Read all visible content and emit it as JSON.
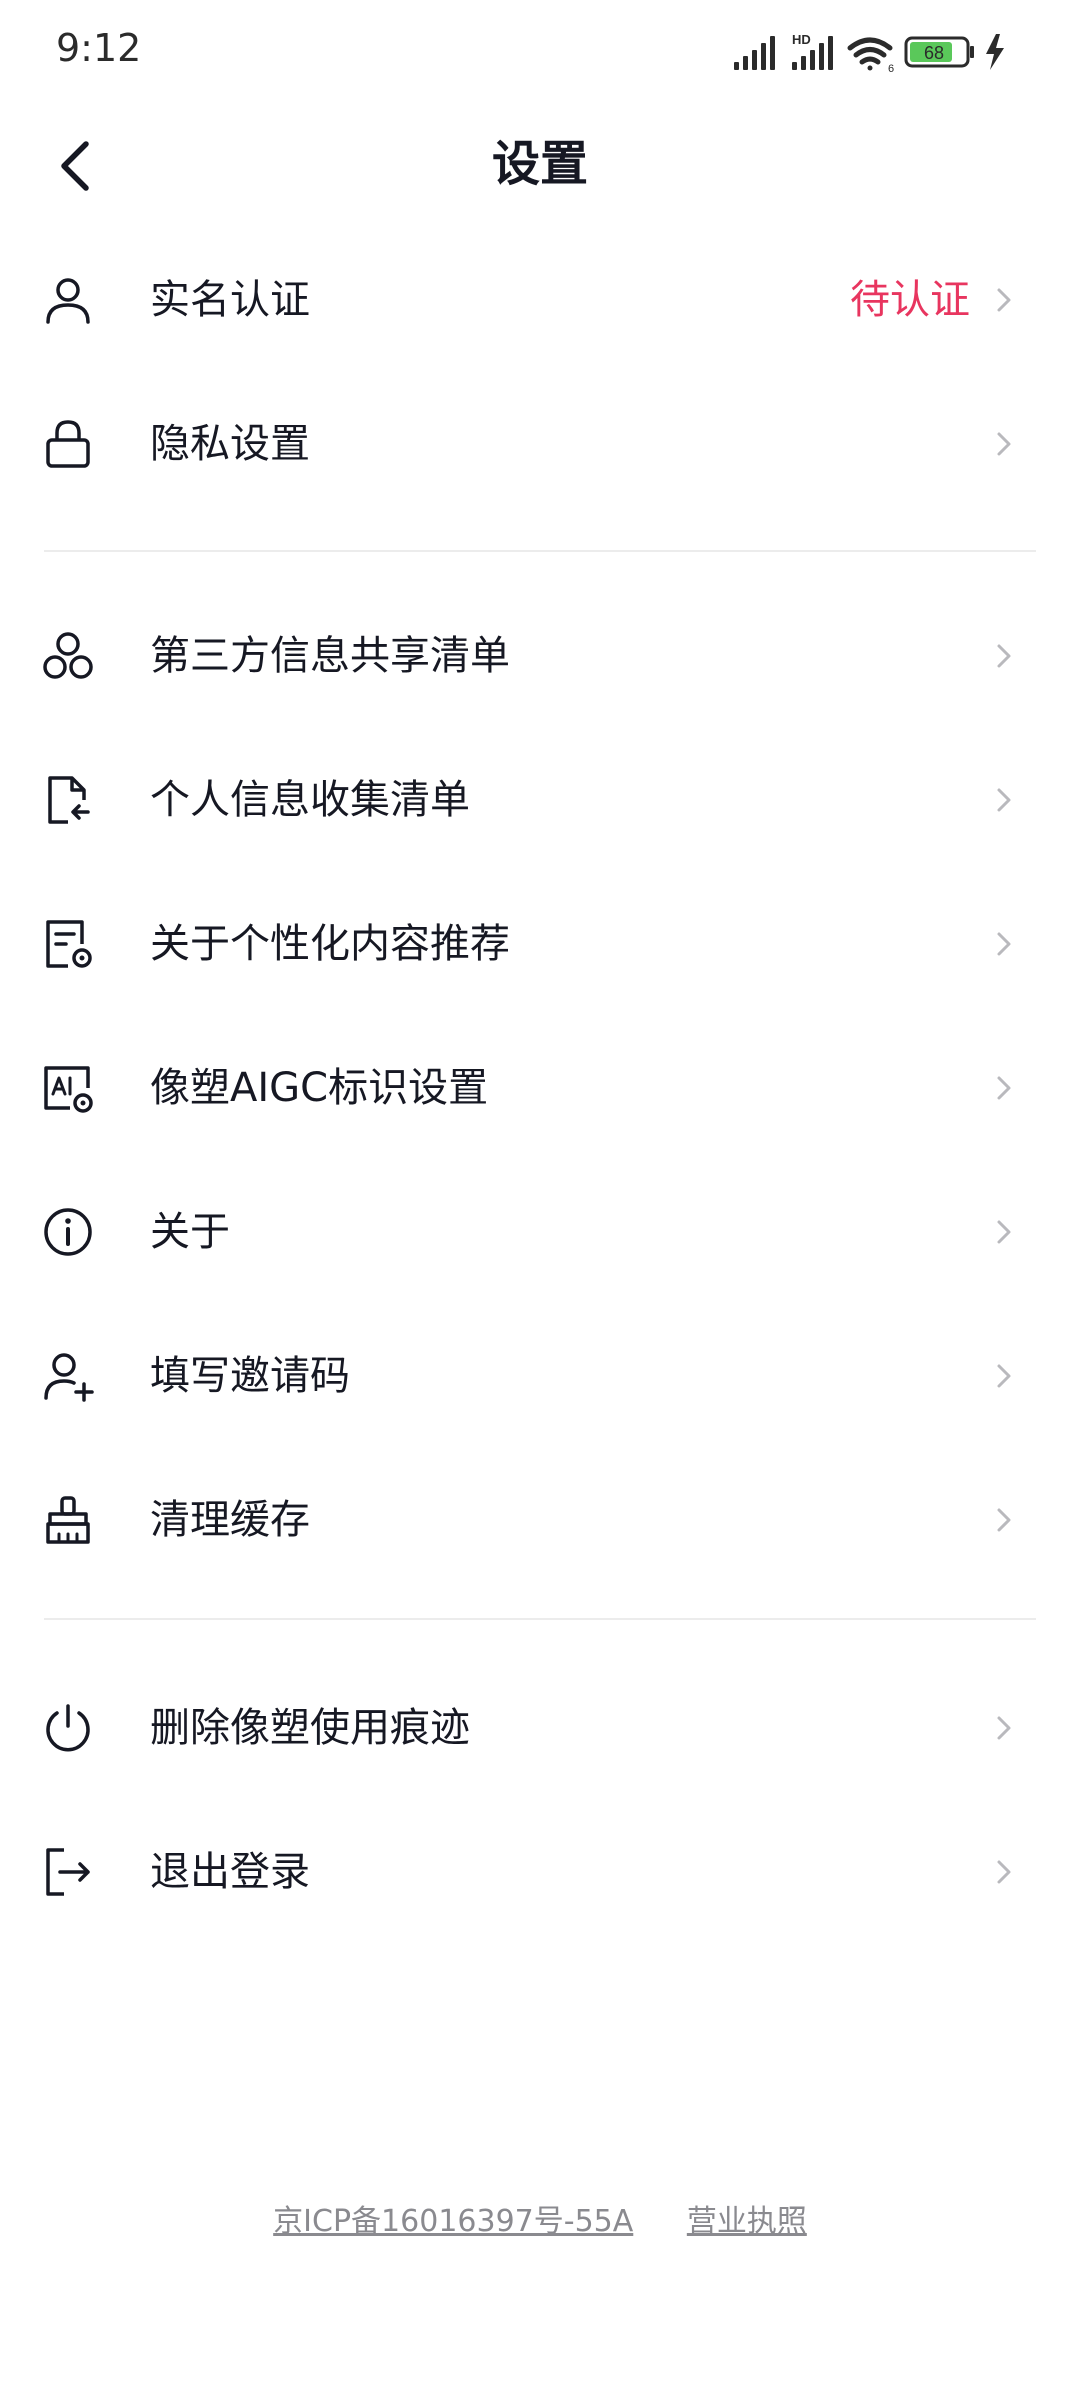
{
  "status_bar": {
    "time": "9:12",
    "network_label": "HD",
    "battery": "68"
  },
  "header": {
    "title": "设置"
  },
  "colors": {
    "accent_pending": "#e8355f",
    "text_primary": "#161823",
    "chevron": "#b9b9bd",
    "divider": "#ececec"
  },
  "group1": [
    {
      "label": "实名认证",
      "icon": "person-icon",
      "status": "待认证"
    },
    {
      "label": "隐私设置",
      "icon": "lock-icon"
    }
  ],
  "group2": [
    {
      "label": "第三方信息共享清单",
      "icon": "share-nodes-icon"
    },
    {
      "label": "个人信息收集清单",
      "icon": "document-return-icon"
    },
    {
      "label": "关于个性化内容推荐",
      "icon": "document-settings-icon"
    },
    {
      "label": "像塑AIGC标识设置",
      "icon": "ai-label-icon"
    },
    {
      "label": "关于",
      "icon": "info-icon"
    },
    {
      "label": "填写邀请码",
      "icon": "add-user-icon"
    },
    {
      "label": "清理缓存",
      "icon": "brush-icon"
    }
  ],
  "group3": [
    {
      "label": "删除像塑使用痕迹",
      "icon": "power-icon"
    },
    {
      "label": "退出登录",
      "icon": "logout-icon"
    }
  ],
  "footer": {
    "icp": "京ICP备16016397号-55A",
    "license": "营业执照"
  }
}
